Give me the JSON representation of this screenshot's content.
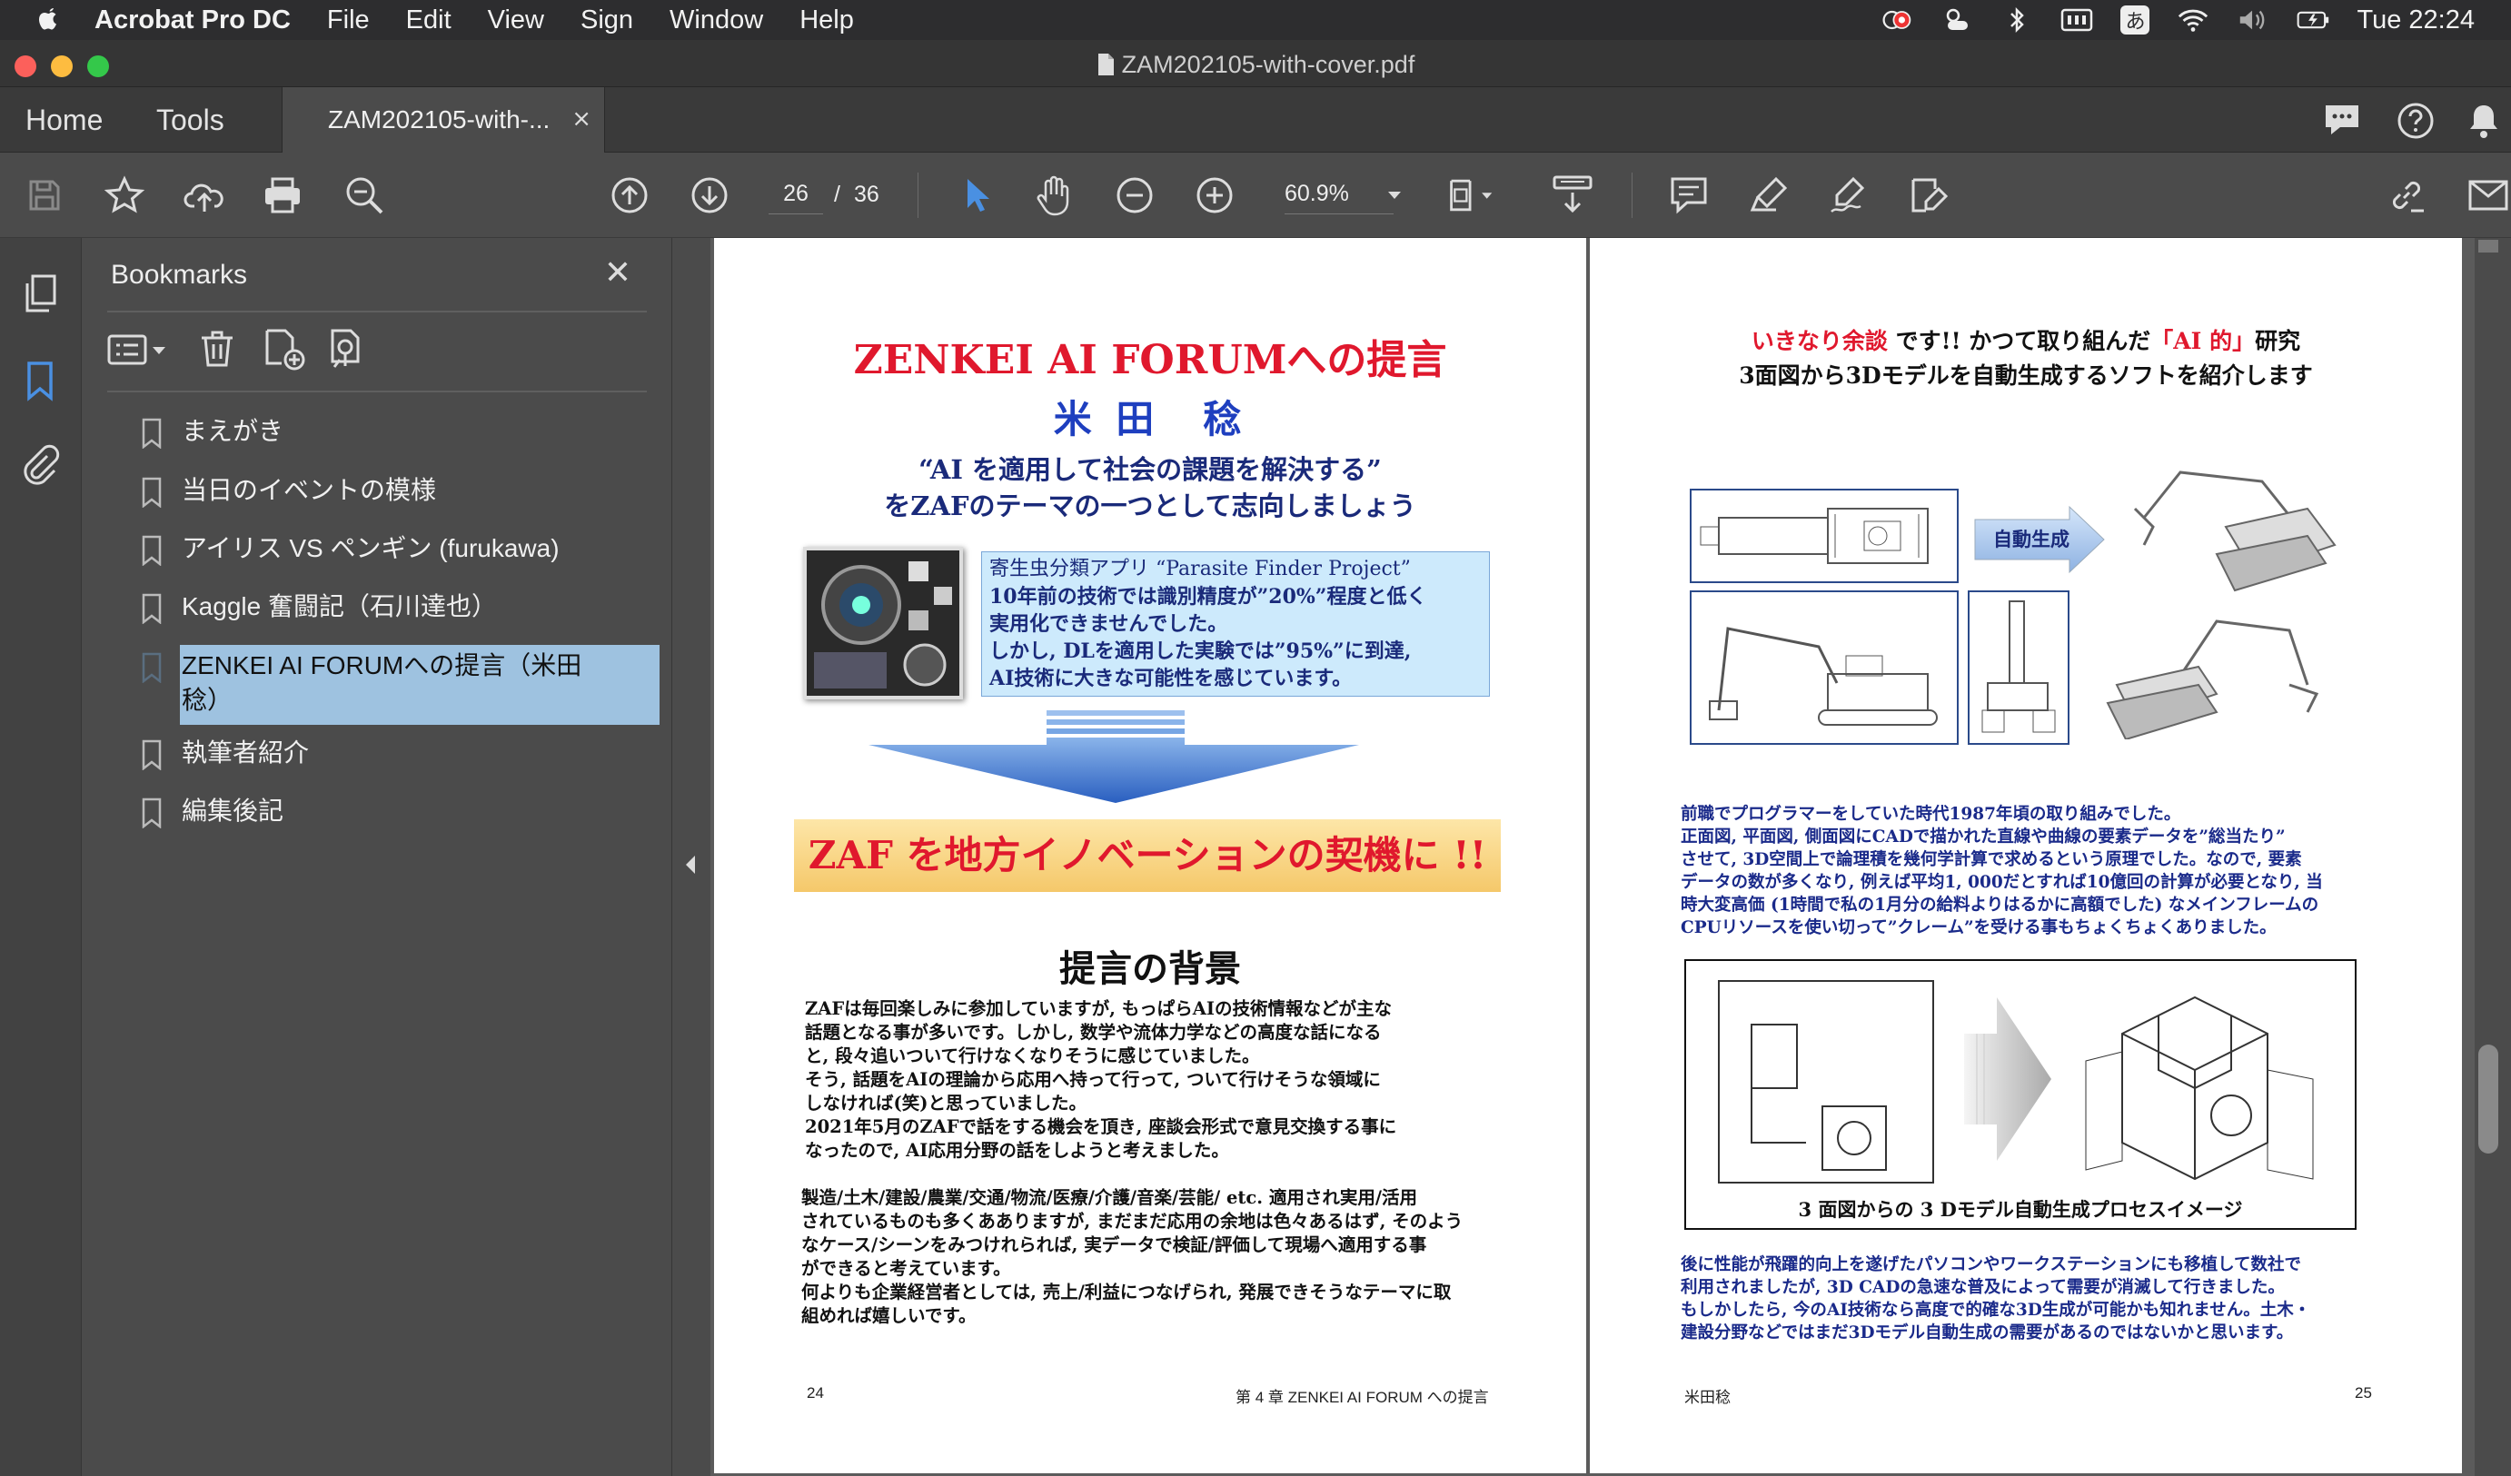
{
  "menubar": {
    "app": "Acrobat Pro DC",
    "items": [
      "File",
      "Edit",
      "View",
      "Sign",
      "Window",
      "Help"
    ],
    "lang": "あ",
    "clock": "Tue 22:24"
  },
  "window": {
    "title": "ZAM202105-with-cover.pdf"
  },
  "tabs": {
    "home": "Home",
    "tools": "Tools",
    "doc": "ZAM202105-with-...",
    "close": "×"
  },
  "toolbar": {
    "page_current": "26",
    "page_sep": "/",
    "page_total": "36",
    "zoom": "60.9%"
  },
  "bookmarks": {
    "title": "Bookmarks",
    "close": "✕",
    "items": [
      {
        "label": "まえがき"
      },
      {
        "label": "当日のイベントの模様"
      },
      {
        "label": "アイリス VS ペンギン (furukawa)"
      },
      {
        "label": "Kaggle 奮闘記（石川達也）"
      },
      {
        "label": "ZENKEI AI FORUMへの提言（米田稔）"
      },
      {
        "label": "執筆者紹介"
      },
      {
        "label": "編集後記"
      }
    ],
    "selected_index": 4
  },
  "colors": {
    "accent": "#4a90e2",
    "selection": "#9ec2e0",
    "title_red": "#e0182d",
    "title_blue": "#1e3fbf"
  },
  "left_page": {
    "title_part1": "ZENKEI AI FORUM",
    "title_part2": "への提言",
    "author": "米 田　稔",
    "slogan1": "“AI を適用して社会の課題を解決する”",
    "slogan2": "をZAFのテーマの一つとして志向しましょう",
    "box_lines": [
      "寄生虫分類アプリ “Parasite Finder Project”",
      "10年前の技術では識別精度が”20%”程度と低く",
      "実用化できませんでした。",
      "しかし, DLを適用した実験では”95%”に到達,",
      "AI技術に大きな可能性を感じています。"
    ],
    "banner": "ZAF を地方イノベーションの契機に !!",
    "section_title": "提言の背景",
    "para1": [
      "ZAFは毎回楽しみに参加していますが, もっぱらAIの技術情報などが主な",
      "話題となる事が多いです。しかし, 数学や流体力学などの高度な話になる",
      "と, 段々追いついて行けなくなりそうに感じていました。",
      "そう, 話題をAIの理論から応用へ持って行って, ついて行けそうな領域に",
      "しなければ(笑)と思っていました。",
      "2021年5月のZAFで話をする機会を頂き, 座談会形式で意見交換する事に",
      "なったので, AI応用分野の話をしようと考えました。"
    ],
    "para2": [
      "製造/土木/建設/農業/交通/物流/医療/介護/音楽/芸能/ etc.  適用され実用/活用",
      "されているものも多くあありますが, まだまだ応用の余地は色々あるはず, そのよう",
      "なケース/シーンをみつけれられば, 実データで検証/評価して現場へ適用する事",
      "ができると考えています。",
      "何よりも企業経営者としては, 売上/利益につなげられ, 発展できそうなテーマに取",
      "組めれば嬉しいです。"
    ],
    "page_number": "24",
    "footer": "第 4 章 ZENKEI AI FORUM への提言"
  },
  "right_page": {
    "head_red1": "いきなり余談",
    "head_black1": " です!! かつて取り組んだ",
    "head_red2": "「AI 的」",
    "head_black2": "研究",
    "head_line2": "3面図から3Dモデルを自動生成するソフトを紹介します",
    "arrow_label": "自動生成",
    "para1": [
      "前職でプログラマーをしていた時代1987年頃の取り組みでした。",
      "正面図, 平面図, 側面図にCADで描かれた直線や曲線の要素データを”総当たり”",
      "させて, 3D空間上で論理積を幾何学計算で求めるという原理でした。なので, 要素",
      "データの数が多くなり, 例えば平均1, 000だとすれば10億回の計算が必要となり, 当",
      "時大変高価 (1時間で私の1月分の給料よりはるかに高額でした) なメインフレームの",
      "CPUリソースを使い切って”クレーム”を受ける事もちょくちょくありました。"
    ],
    "figure_caption": "3 面図からの 3 Dモデル自動生成プロセスイメージ",
    "para2": [
      "後に性能が飛躍的向上を遂げたパソコンやワークステーションにも移植して数社で",
      "利用されましたが, 3D CADの急速な普及によって需要が消滅して行きました。",
      "もしかしたら, 今のAI技術なら高度で的確な3D生成が可能かも知れません。土木・",
      "建設分野などではまだ3Dモデル自動生成の需要があるのではないかと思います。"
    ],
    "footer_author": "米田稔",
    "page_number": "25"
  }
}
